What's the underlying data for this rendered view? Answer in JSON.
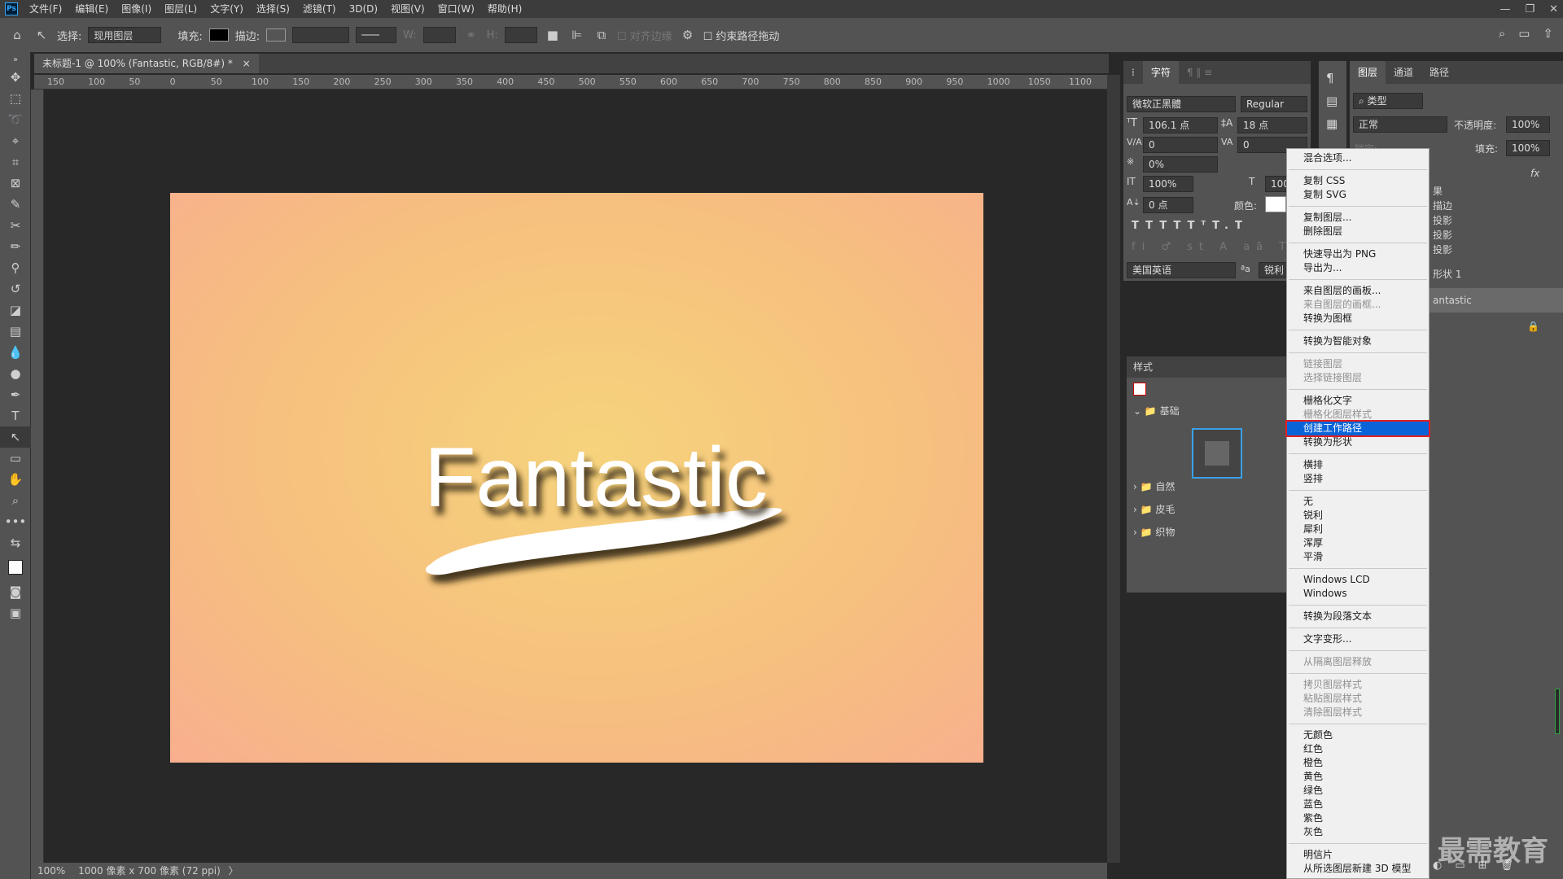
{
  "menubar": {
    "logo": "Ps",
    "items": [
      "文件(F)",
      "编辑(E)",
      "图像(I)",
      "图层(L)",
      "文字(Y)",
      "选择(S)",
      "滤镜(T)",
      "3D(D)",
      "视图(V)",
      "窗口(W)",
      "帮助(H)"
    ],
    "window_buttons": [
      "—",
      "❐",
      "✕"
    ]
  },
  "options": {
    "select_label": "选择:",
    "select_value": "现用图层",
    "fill_label": "填充:",
    "stroke_label": "描边:",
    "w_label": "W:",
    "h_label": "H:",
    "align_edges": "对齐边缘",
    "constrain_path": "约束路径拖动"
  },
  "document": {
    "tab_title": "未标题-1 @ 100% (Fantastic, RGB/8#) *",
    "tab_close": "×",
    "artwork_text": "Fantastic",
    "status_zoom": "100%",
    "status_info": "1000 像素 x 700 像素 (72 ppi)",
    "status_arrow": "〉"
  },
  "ruler": {
    "h_labels": [
      "150",
      "100",
      "50",
      "0",
      "50",
      "100",
      "150",
      "200",
      "250",
      "300",
      "350",
      "400",
      "450",
      "500",
      "550",
      "600",
      "650",
      "700",
      "750",
      "800",
      "850",
      "900",
      "950",
      "1000",
      "1050",
      "1100"
    ]
  },
  "character": {
    "tabs": [
      "字符"
    ],
    "font_family": "微软正黑體",
    "font_style": "Regular",
    "size": "106.1 点",
    "leading": "18 点",
    "kerning": "0",
    "tracking": "0",
    "scale_pct": "0%",
    "vscale": "100%",
    "hscale": "100",
    "baseline": "0 点",
    "color_label": "颜色:",
    "language": "美国英语",
    "antialias": "锐利",
    "aa_icon": "ªa"
  },
  "styles": {
    "title": "样式",
    "groups": [
      "基础",
      "自然",
      "皮毛",
      "织物"
    ]
  },
  "layers": {
    "tabs": [
      "图层",
      "通道",
      "路径"
    ],
    "kind": "类型",
    "blend": "正常",
    "opacity_label": "不透明度:",
    "opacity": "100%",
    "lock_label": "锁定:",
    "fill_label": "填充:",
    "fill": "100%",
    "fx": "fx",
    "effects": [
      "果",
      "描边",
      "投影",
      "投影",
      "投影"
    ],
    "rows": [
      "形状 1",
      "antastic"
    ]
  },
  "context_menu": {
    "groups": [
      [
        {
          "label": "混合选项...",
          "enabled": true
        }
      ],
      [
        {
          "label": "复制 CSS",
          "enabled": true
        },
        {
          "label": "复制 SVG",
          "enabled": true
        }
      ],
      [
        {
          "label": "复制图层...",
          "enabled": true
        },
        {
          "label": "删除图层",
          "enabled": true
        }
      ],
      [
        {
          "label": "快速导出为 PNG",
          "enabled": true
        },
        {
          "label": "导出为...",
          "enabled": true
        }
      ],
      [
        {
          "label": "来自图层的画板...",
          "enabled": true
        },
        {
          "label": "来自图层的画框...",
          "enabled": false
        },
        {
          "label": "转换为图框",
          "enabled": true
        }
      ],
      [
        {
          "label": "转换为智能对象",
          "enabled": true
        }
      ],
      [
        {
          "label": "链接图层",
          "enabled": false
        },
        {
          "label": "选择链接图层",
          "enabled": false
        }
      ],
      [
        {
          "label": "栅格化文字",
          "enabled": true
        },
        {
          "label": "栅格化图层样式",
          "enabled": false
        },
        {
          "label": "创建工作路径",
          "enabled": true,
          "highlighted": true
        },
        {
          "label": "转换为形状",
          "enabled": true
        }
      ],
      [
        {
          "label": "横排",
          "enabled": true
        },
        {
          "label": "竖排",
          "enabled": true
        }
      ],
      [
        {
          "label": "无",
          "enabled": true
        },
        {
          "label": "锐利",
          "enabled": true
        },
        {
          "label": "犀利",
          "enabled": true
        },
        {
          "label": "浑厚",
          "enabled": true
        },
        {
          "label": "平滑",
          "enabled": true
        }
      ],
      [
        {
          "label": "Windows LCD",
          "enabled": true
        },
        {
          "label": "Windows",
          "enabled": true
        }
      ],
      [
        {
          "label": "转换为段落文本",
          "enabled": true
        }
      ],
      [
        {
          "label": "文字变形...",
          "enabled": true
        }
      ],
      [
        {
          "label": "从隔离图层释放",
          "enabled": false
        }
      ],
      [
        {
          "label": "拷贝图层样式",
          "enabled": false
        },
        {
          "label": "粘贴图层样式",
          "enabled": false
        },
        {
          "label": "清除图层样式",
          "enabled": false
        }
      ],
      [
        {
          "label": "无颜色",
          "enabled": true
        },
        {
          "label": "红色",
          "enabled": true
        },
        {
          "label": "橙色",
          "enabled": true
        },
        {
          "label": "黄色",
          "enabled": true
        },
        {
          "label": "绿色",
          "enabled": true
        },
        {
          "label": "蓝色",
          "enabled": true
        },
        {
          "label": "紫色",
          "enabled": true
        },
        {
          "label": "灰色",
          "enabled": true
        }
      ],
      [
        {
          "label": "明信片",
          "enabled": true
        },
        {
          "label": "从所选图层新建 3D 模型",
          "enabled": true
        }
      ]
    ]
  },
  "watermark": "最需教育",
  "colors": {
    "accent_highlight": "#0a64d8",
    "highlight_border": "#e02020",
    "artboard_center": "#f6d37c",
    "artboard_edge": "#f8af8e"
  }
}
